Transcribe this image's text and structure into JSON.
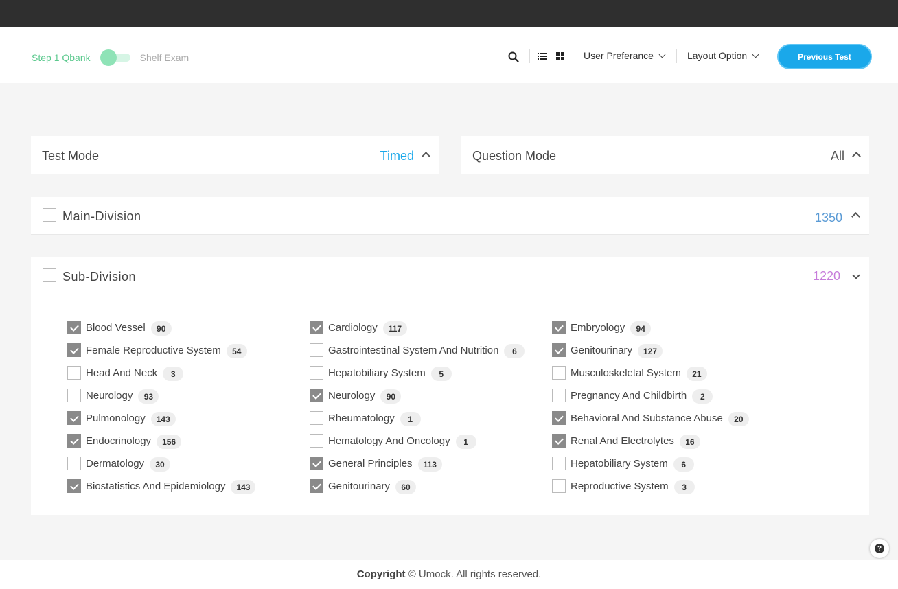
{
  "header": {
    "toggle_on_label": "Step 1 Qbank",
    "toggle_off_label": "Shelf Exam",
    "user_preference_label": "User Preferance",
    "layout_option_label": "Layout Option",
    "previous_test_label": "Previous Test"
  },
  "test_mode": {
    "title": "Test Mode",
    "value": "Timed",
    "value_color": "#1aa8ea"
  },
  "question_mode": {
    "title": "Question Mode",
    "value": "All"
  },
  "main_division": {
    "title": "Main-Division",
    "count": "1350",
    "count_color": "#5b9bd5"
  },
  "sub_division": {
    "title": "Sub-Division",
    "count": "1220",
    "count_color": "#c77ddb",
    "columns": [
      [
        {
          "label": "Blood Vessel",
          "count": "90",
          "checked": true
        },
        {
          "label": "Female Reproductive System",
          "count": "54",
          "checked": true
        },
        {
          "label": "Head And Neck",
          "count": "3",
          "checked": false
        },
        {
          "label": "Neurology",
          "count": "93",
          "checked": false
        },
        {
          "label": "Pulmonology",
          "count": "143",
          "checked": true
        },
        {
          "label": "Endocrinology",
          "count": "156",
          "checked": true
        },
        {
          "label": "Dermatology",
          "count": "30",
          "checked": false
        },
        {
          "label": "Biostatistics And Epidemiology",
          "count": "143",
          "checked": true
        }
      ],
      [
        {
          "label": "Cardiology",
          "count": "117",
          "checked": true
        },
        {
          "label": "Gastrointestinal System And Nutrition",
          "count": "6",
          "checked": false
        },
        {
          "label": "Hepatobiliary System",
          "count": "5",
          "checked": false
        },
        {
          "label": "Neurology",
          "count": "90",
          "checked": true
        },
        {
          "label": "Rheumatology",
          "count": "1",
          "checked": false
        },
        {
          "label": "Hematology And Oncology",
          "count": "1",
          "checked": false
        },
        {
          "label": "General Principles",
          "count": "113",
          "checked": true
        },
        {
          "label": "Genitourinary",
          "count": "60",
          "checked": true
        }
      ],
      [
        {
          "label": "Embryology",
          "count": "94",
          "checked": true
        },
        {
          "label": "Genitourinary",
          "count": "127",
          "checked": true
        },
        {
          "label": "Musculoskeletal System",
          "count": "21",
          "checked": false
        },
        {
          "label": "Pregnancy And Childbirth",
          "count": "2",
          "checked": false
        },
        {
          "label": "Behavioral And Substance Abuse",
          "count": "20",
          "checked": true
        },
        {
          "label": "Renal And Electrolytes",
          "count": "16",
          "checked": true
        },
        {
          "label": "Hepatobiliary System",
          "count": "6",
          "checked": false
        },
        {
          "label": "Reproductive System",
          "count": "3",
          "checked": false
        }
      ]
    ]
  },
  "footer": {
    "bold": "Copyright",
    "text": "© Umock. All rights reserved."
  }
}
